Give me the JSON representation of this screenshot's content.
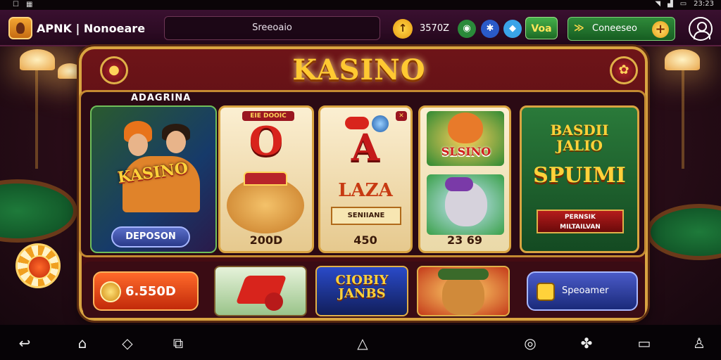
{
  "status_bar": {
    "left_icons": [
      "☐",
      "▦"
    ],
    "time": "23:23"
  },
  "top_bar": {
    "app_name": "APNK | Nonoeare",
    "search_text": "Sreeoaio",
    "coin_count": "3570Z",
    "vip_label": "Voa",
    "connect_label": "Coneeseo",
    "plus_label": "+"
  },
  "game": {
    "title": "KASINO",
    "section_label": "ADAGRINA",
    "panel1": {
      "logo_text": "KASINO",
      "button_label": "DEPOSON"
    },
    "panel2": {
      "tag": "EIE DOOIC",
      "glyph": "O",
      "value": "200D"
    },
    "panel3": {
      "glyph": "A",
      "middle_text": "LAZA",
      "banner_text": "SENIIANE",
      "value": "450"
    },
    "panel4": {
      "top_text": "SLSINO",
      "value": "23 69"
    },
    "panel5": {
      "title_line1": "BASDII",
      "title_line2": "JALIO",
      "spin_text": "SPUIMI",
      "banner_line1": "PERNSIK",
      "banner_line2": "MILTAILVAN"
    }
  },
  "bottom_row": {
    "coins_value": "6.550D",
    "tile2_line1": "CIOBIY",
    "tile2_line2": "JANBS",
    "special_label": "Speoamer"
  },
  "colors": {
    "accent_gold": "#ffc932",
    "cabinet_red": "#6e1418",
    "felt_green": "#1e7a3a"
  },
  "icons": [
    "back-icon",
    "home-icon",
    "recents-icon",
    "screenshot-icon",
    "home-outline-icon",
    "compass-icon",
    "puzzle-icon",
    "window-icon",
    "person-icon"
  ]
}
